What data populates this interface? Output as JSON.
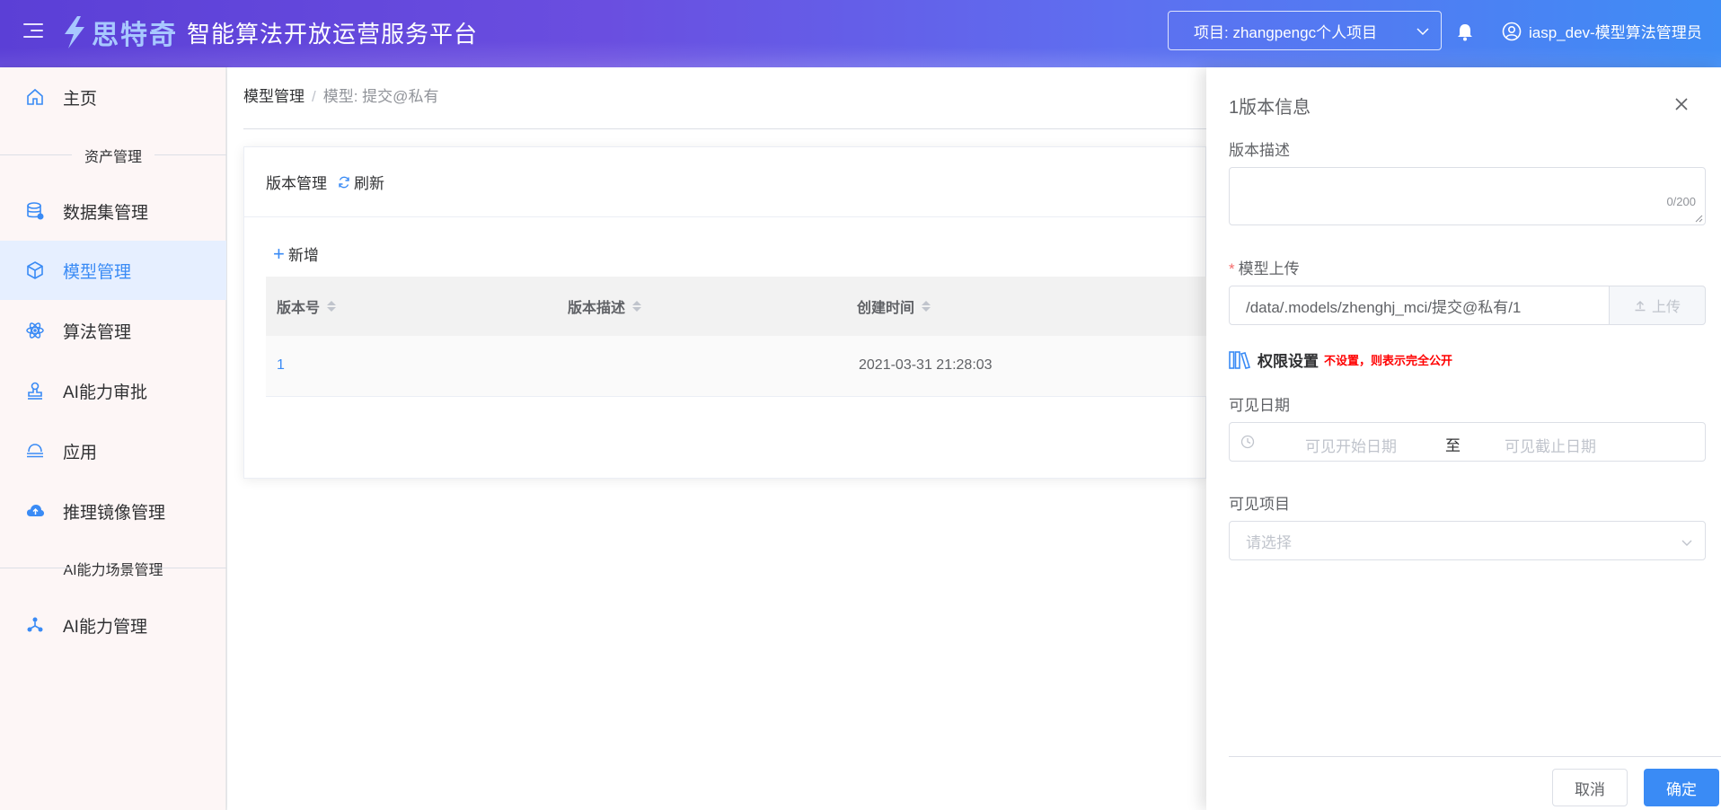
{
  "header": {
    "brand": "思特奇",
    "platform_title": "智能算法开放运营服务平台",
    "project_select": "项目: zhangpengc个人项目",
    "user_name": "iasp_dev-模型算法管理员"
  },
  "sidebar": {
    "items": [
      {
        "label": "主页",
        "icon": "home-icon"
      },
      {
        "label": "数据集管理",
        "icon": "database-icon"
      },
      {
        "label": "模型管理",
        "icon": "cube-icon"
      },
      {
        "label": "算法管理",
        "icon": "atom-icon"
      },
      {
        "label": "AI能力审批",
        "icon": "stamp-icon"
      },
      {
        "label": "应用",
        "icon": "app-icon"
      },
      {
        "label": "推理镜像管理",
        "icon": "cloud-upload-icon"
      },
      {
        "label": "AI能力管理",
        "icon": "network-icon"
      }
    ],
    "groups": [
      "资产管理",
      "AI能力场景管理"
    ],
    "active_item": "模型管理"
  },
  "breadcrumb": {
    "root": "模型管理",
    "separator": "/",
    "current": "模型:  提交@私有"
  },
  "card": {
    "title": "版本管理",
    "refresh_label": "刷新",
    "add_label": "新增"
  },
  "table": {
    "columns": [
      "版本号",
      "版本描述",
      "创建时间"
    ],
    "rows": [
      {
        "version": "1",
        "description": "",
        "created": "2021-03-31 21:28:03"
      }
    ]
  },
  "drawer": {
    "title": "1版本信息",
    "desc_label": "版本描述",
    "desc_value": "",
    "desc_counter": "0/200",
    "upload_label": "模型上传",
    "upload_path": "/data/.models/zhenghj_mci/提交@私有/1",
    "upload_button": "上传",
    "perm_title": "权限设置",
    "perm_hint": "不设置，则表示完全公开",
    "date_label": "可见日期",
    "date_start_placeholder": "可见开始日期",
    "date_separator": "至",
    "date_end_placeholder": "可见截止日期",
    "project_label": "可见项目",
    "project_placeholder": "请选择",
    "cancel": "取消",
    "confirm": "确定"
  },
  "colors": {
    "accent": "#3a8bf5",
    "active_bg": "#e6efff",
    "required": "#f56c6c",
    "hint_red": "#ff0000"
  }
}
